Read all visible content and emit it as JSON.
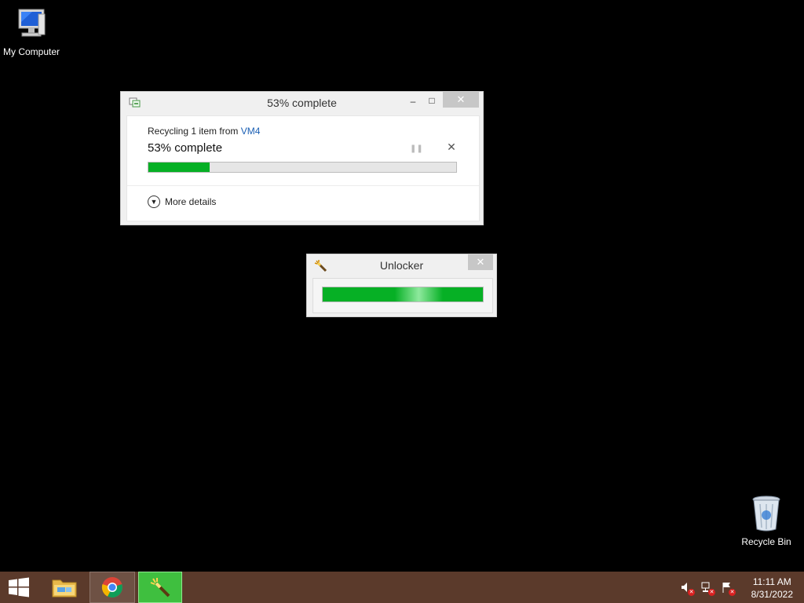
{
  "desktop": {
    "icons": [
      {
        "label": "My Computer",
        "icon": "monitor-icon"
      },
      {
        "label": "Recycle Bin",
        "icon": "recycle-bin-icon"
      }
    ]
  },
  "progress_dialog": {
    "title": "53% complete",
    "recycling_prefix": "Recycling 1 item from ",
    "recycling_source": "VM4",
    "percent_text": "53% complete",
    "progress": 0.2,
    "more_details": "More details",
    "buttons": {
      "minimize": "–",
      "maximize": "□",
      "close": "✕",
      "pause": "❚❚",
      "cancel": "✕"
    }
  },
  "unlocker": {
    "title": "Unlocker",
    "close": "✕",
    "icon": "wand-icon",
    "marquee": "indeterminate"
  },
  "taskbar": {
    "apps": [
      {
        "name": "start",
        "icon": "windows-logo-icon"
      },
      {
        "name": "file-explorer",
        "icon": "folder-icon"
      },
      {
        "name": "chrome",
        "icon": "chrome-icon"
      },
      {
        "name": "unlocker",
        "icon": "wand-icon",
        "active": true
      }
    ],
    "tray": [
      {
        "icon": "speaker-muted-icon"
      },
      {
        "icon": "network-icon"
      },
      {
        "icon": "action-center-flag-icon"
      }
    ],
    "time": "11:11 AM",
    "date": "8/31/2022"
  },
  "colors": {
    "desktop": "#000000",
    "taskbar": "#5b3a2b",
    "progress_green": "#06b025",
    "link_blue": "#1a5fb4"
  }
}
